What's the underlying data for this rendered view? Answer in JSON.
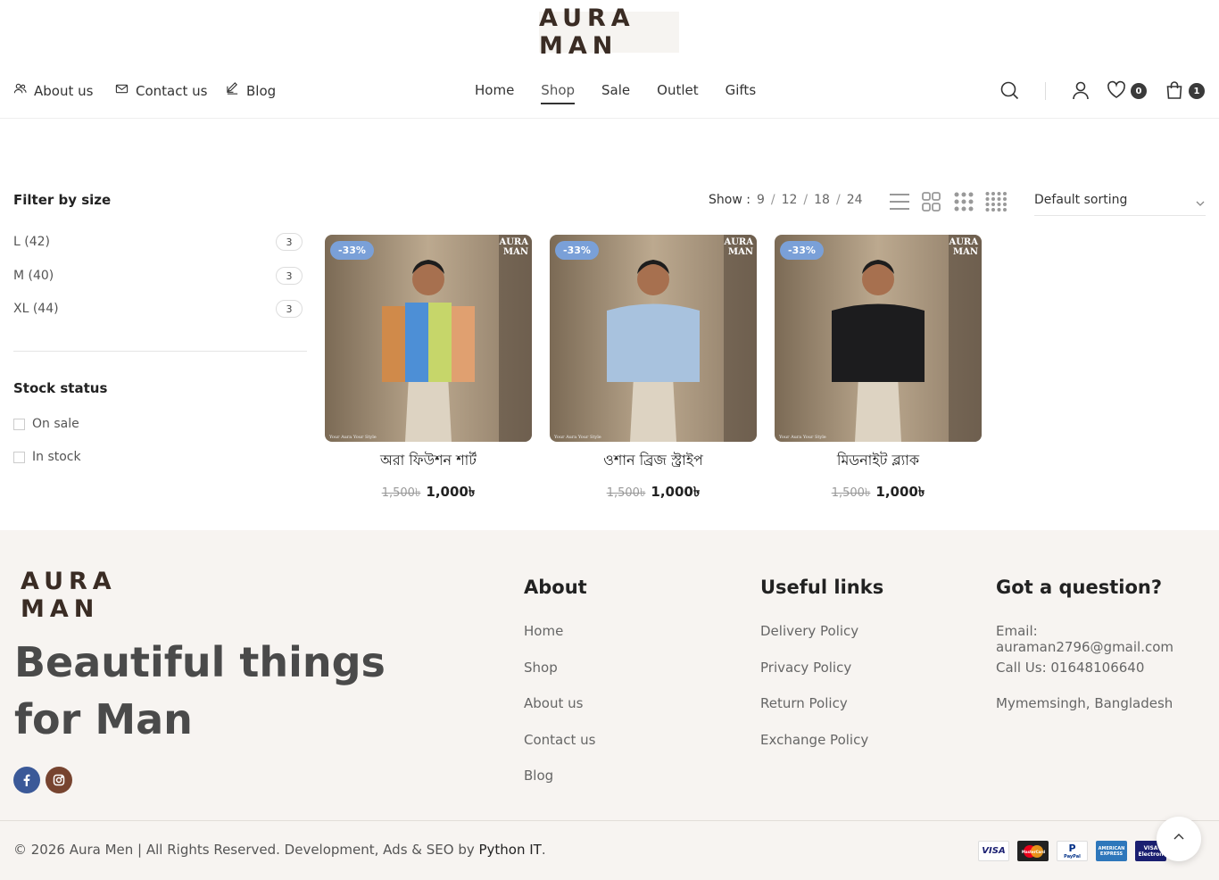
{
  "header": {
    "logo": "AURA MAN",
    "top_links": [
      {
        "label": "About us",
        "icon": "people-icon"
      },
      {
        "label": "Contact us",
        "icon": "mail-icon"
      },
      {
        "label": "Blog",
        "icon": "edit-icon"
      }
    ],
    "nav": [
      "Home",
      "Shop",
      "Sale",
      "Outlet",
      "Gifts"
    ],
    "active_nav": "Shop",
    "wishlist_count": "0",
    "cart_count": "1"
  },
  "sidebar": {
    "filter_title": "Filter by size",
    "sizes": [
      {
        "label": "L (42)",
        "count": "3"
      },
      {
        "label": "M (40)",
        "count": "3"
      },
      {
        "label": "XL (44)",
        "count": "3"
      }
    ],
    "stock_title": "Stock status",
    "stock_options": [
      "On sale",
      "In stock"
    ]
  },
  "toolbar": {
    "show_label": "Show :",
    "show_options": [
      "9",
      "12",
      "18",
      "24"
    ],
    "sort_label": "Default sorting"
  },
  "products": [
    {
      "name": "অরা ফিউশন শার্ট",
      "badge": "-33%",
      "old_price": "1,500৳",
      "price": "1,000৳",
      "shirt_colors": [
        "#d08a4a",
        "#4d8fd6",
        "#c6d66a",
        "#e0a070"
      ]
    },
    {
      "name": "ওশান ব্রিজ স্ট্রাইপ",
      "badge": "-33%",
      "old_price": "1,500৳",
      "price": "1,000৳",
      "shirt_colors": [
        "#a8c2de"
      ]
    },
    {
      "name": "মিডনাইট ব্ল্যাক",
      "badge": "-33%",
      "old_price": "1,500৳",
      "price": "1,000৳",
      "shirt_colors": [
        "#1c1c1e"
      ]
    }
  ],
  "watermark": {
    "line1": "AURA",
    "line2": "MAN",
    "tagline": "Your Aura Your Style"
  },
  "footer": {
    "logo": "AURA MAN",
    "tagline": "Beautiful things for Man",
    "about": {
      "title": "About",
      "links": [
        "Home",
        "Shop",
        "About us",
        "Contact us",
        "Blog"
      ]
    },
    "useful": {
      "title": "Useful links",
      "links": [
        "Delivery Policy",
        "Privacy Policy",
        "Return Policy",
        "Exchange Policy"
      ]
    },
    "contact": {
      "title": "Got a question?",
      "lines": [
        "Email: auraman2796@gmail.com",
        "Call Us: 01648106640",
        "Mymemsingh, Bangladesh"
      ]
    },
    "copyright": "© 2026 Aura Men | All Rights Reserved. Development, Ads & SEO by ",
    "copyright_link": "Python IT",
    "copyright_end": ".",
    "payments": [
      "VISA",
      "MasterCard",
      "PayPal",
      "AMERICAN EXPRESS",
      "VISA Electron"
    ],
    "colors": {
      "facebook": "#3b5998",
      "instagram": "#774430"
    }
  }
}
